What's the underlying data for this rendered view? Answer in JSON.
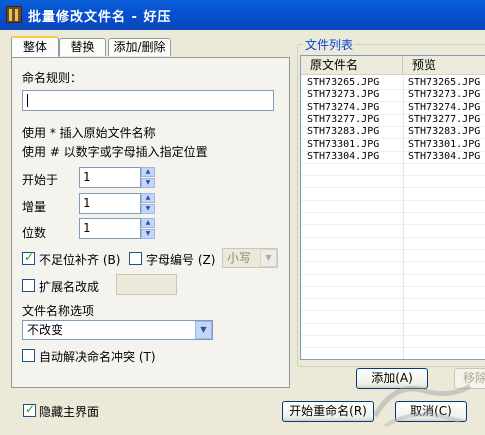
{
  "window": {
    "title": "批量修改文件名 - 好压"
  },
  "tabs": [
    {
      "label": "整体",
      "active": true
    },
    {
      "label": "替换",
      "active": false
    },
    {
      "label": "添加/删除",
      "active": false
    }
  ],
  "naming": {
    "rule_label": "命名规则：",
    "rule_value": "",
    "hint_line1": "使用 * 插入原始文件名称",
    "hint_line2": "使用 # 以数字或字母插入指定位置",
    "start_label": "开始于",
    "start_value": "1",
    "step_label": "增量",
    "step_value": "1",
    "digits_label": "位数",
    "digits_value": "1",
    "pad_label": "不足位补齐 (B)",
    "pad_checked": true,
    "alpha_label": "字母编号 (Z)",
    "alpha_checked": false,
    "case_value": "小写",
    "ext_label": "扩展名改成",
    "ext_checked": false,
    "ext_value": "",
    "options_label": "文件名称选项",
    "options_value": "不改变",
    "resolve_label": "自动解决命名冲突 (T)",
    "resolve_checked": false
  },
  "file_list": {
    "title": "文件列表",
    "columns": [
      "原文件名",
      "预览"
    ],
    "rows": [
      [
        "STH73265.JPG",
        "STH73265.JPG"
      ],
      [
        "STH73273.JPG",
        "STH73273.JPG"
      ],
      [
        "STH73274.JPG",
        "STH73274.JPG"
      ],
      [
        "STH73277.JPG",
        "STH73277.JPG"
      ],
      [
        "STH73283.JPG",
        "STH73283.JPG"
      ],
      [
        "STH73301.JPG",
        "STH73301.JPG"
      ],
      [
        "STH73304.JPG",
        "STH73304.JPG"
      ]
    ],
    "add_button": "添加(A)",
    "remove_button": "移除"
  },
  "footer": {
    "hide_ui_label": "隐藏主界面",
    "hide_ui_checked": true,
    "start_button": "开始重命名(R)",
    "cancel_button": "取消(C)"
  },
  "colors": {
    "titlebar": "#0550d0",
    "accent": "#ffc83c",
    "group_title": "#0046d5"
  }
}
